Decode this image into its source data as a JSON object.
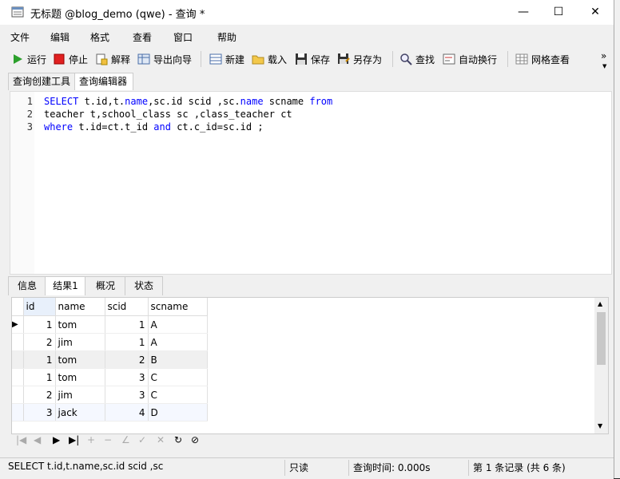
{
  "window": {
    "title": "无标题 @blog_demo (qwe) - 查询 *",
    "min": "—",
    "max": "☐",
    "close": "✕"
  },
  "menu": [
    "文件",
    "编辑",
    "格式",
    "查看",
    "窗口",
    "帮助"
  ],
  "toolbar": {
    "run": "运行",
    "stop": "停止",
    "explain": "解释",
    "export": "导出向导",
    "new": "新建",
    "load": "载入",
    "save": "保存",
    "saveas": "另存为",
    "find": "查找",
    "wrap": "自动换行",
    "grid": "网格查看",
    "more": "»"
  },
  "query_tabs": [
    "查询创建工具",
    "查询编辑器"
  ],
  "editor": {
    "line_numbers": [
      "1",
      "2",
      "3"
    ],
    "lines": [
      [
        {
          "t": "SELECT",
          "k": 1
        },
        {
          "t": " t.id,t.",
          "k": 0
        },
        {
          "t": "name",
          "k": 2
        },
        {
          "t": ",sc.id scid ,sc.",
          "k": 0
        },
        {
          "t": "name",
          "k": 2
        },
        {
          "t": " scname ",
          "k": 0
        },
        {
          "t": "from",
          "k": 1
        }
      ],
      [
        {
          "t": "teacher t,school_class sc ,class_teacher ct",
          "k": 0
        }
      ],
      [
        {
          "t": "where",
          "k": 1
        },
        {
          "t": " t.id=ct.t_id ",
          "k": 0
        },
        {
          "t": "and",
          "k": 1
        },
        {
          "t": " ct.c_id=sc.id ;",
          "k": 0
        }
      ]
    ]
  },
  "result_tabs": [
    "信息",
    "结果1",
    "概况",
    "状态"
  ],
  "grid": {
    "columns": [
      "id",
      "name",
      "scid",
      "scname"
    ],
    "rows": [
      [
        "1",
        "tom",
        "1",
        "A"
      ],
      [
        "2",
        "jim",
        "1",
        "A"
      ],
      [
        "1",
        "tom",
        "2",
        "B"
      ],
      [
        "1",
        "tom",
        "3",
        "C"
      ],
      [
        "2",
        "jim",
        "3",
        "C"
      ],
      [
        "3",
        "jack",
        "4",
        "D"
      ]
    ]
  },
  "status": {
    "sql": "SELECT t.id,t.name,sc.id scid ,sc",
    "mode": "只读",
    "time": "查询时间: 0.000s",
    "record": "第 1 条记录 (共 6 条)"
  },
  "colors": {
    "keyword": "#0000ff",
    "run_green": "#2ca02c",
    "stop_red": "#e02020"
  }
}
